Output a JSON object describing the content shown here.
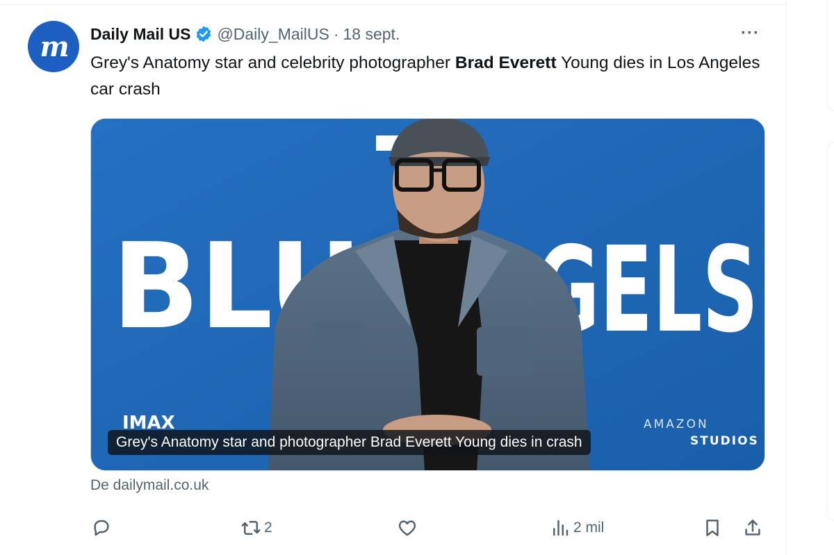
{
  "account": {
    "avatar_letters": "m",
    "name": "Daily Mail US",
    "handle": "@Daily_MailUS",
    "separator": "·",
    "date": "18 sept."
  },
  "more_label": "···",
  "tweet": {
    "text_before": "Grey's Anatomy star and celebrity photographer ",
    "text_bold": "Brad Everett",
    "text_after": " Young dies in Los Angeles car crash"
  },
  "media": {
    "backdrop_text_left": "BLU",
    "backdrop_text_right": "GELS",
    "backdrop_logo_left": "IMAX",
    "backdrop_logo_amazon": "AMAZON",
    "backdrop_logo_studios": "STUDIOS",
    "caption": "Grey's Anatomy star and photographer Brad Everett Young dies in crash"
  },
  "source": "De dailymail.co.uk",
  "actions": {
    "retweets": "2",
    "views": "2 mil"
  },
  "colors": {
    "brand": "#1d5fc1",
    "verified": "#1d9bf0",
    "muted": "#536471",
    "backdrop": "#1f67b8"
  },
  "icons": [
    "verified-icon",
    "more-icon",
    "reply-icon",
    "retweet-icon",
    "like-icon",
    "views-icon",
    "bookmark-icon",
    "share-icon"
  ]
}
